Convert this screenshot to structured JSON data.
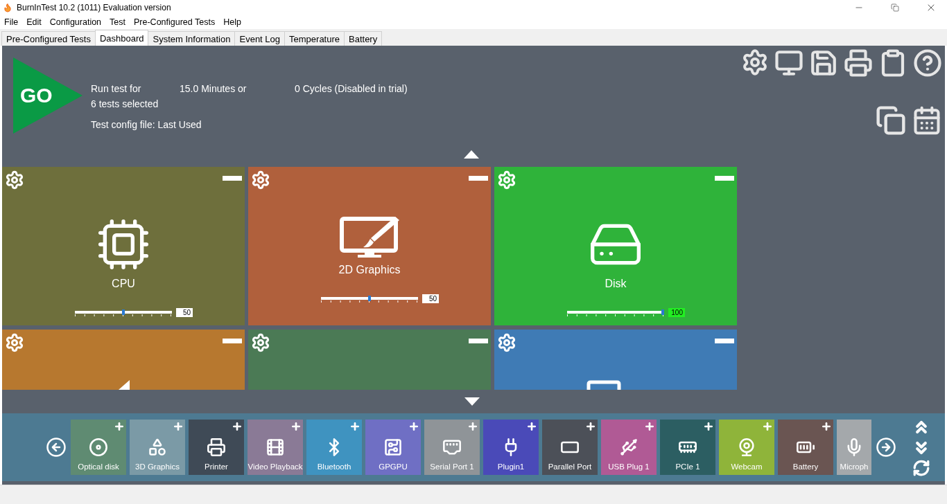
{
  "window": {
    "title": "BurnInTest 10.2 (1011) Evaluation version"
  },
  "menu": [
    "File",
    "Edit",
    "Configuration",
    "Test",
    "Pre-Configured Tests",
    "Help"
  ],
  "tabs": [
    {
      "label": "Pre-Configured Tests",
      "selected": false
    },
    {
      "label": "Dashboard",
      "selected": true
    },
    {
      "label": "System Information",
      "selected": false
    },
    {
      "label": "Event Log",
      "selected": false
    },
    {
      "label": "Temperature",
      "selected": false
    },
    {
      "label": "Battery",
      "selected": false
    }
  ],
  "go_button": {
    "label": "GO"
  },
  "run_info": {
    "run_test_for": "Run test for",
    "duration": "15.0 Minutes or",
    "cycles": "0 Cycles (Disabled in trial)",
    "tests_selected": "6 tests selected",
    "config_file": "Test config file: Last Used"
  },
  "test_tiles": [
    {
      "label": "CPU",
      "color": "#6e6f3c",
      "level": 0.5,
      "reading": "50",
      "reading_highlighted": false
    },
    {
      "label": "2D Graphics",
      "color": "#b0603c",
      "level": 0.5,
      "reading": "50",
      "reading_highlighted": false
    },
    {
      "label": "Disk",
      "color": "#2fb33a",
      "level": 1,
      "reading": "100",
      "reading_highlighted": true
    },
    {
      "color": "#b7782f"
    },
    {
      "color": "#4b7a55"
    },
    {
      "color": "#3f7bb5"
    }
  ],
  "available_tests": [
    {
      "label": "Optical disk",
      "color": "#5f8b72",
      "add": true
    },
    {
      "label": "3D Graphics",
      "color": "#7b9aa6",
      "add": true
    },
    {
      "label": "Printer",
      "color": "#3f4a56",
      "add": true
    },
    {
      "label": "Video Playback",
      "color": "#8a7a96",
      "add": true
    },
    {
      "label": "Bluetooth",
      "color": "#3f93c0",
      "add": true
    },
    {
      "label": "GPGPU",
      "color": "#6f6fc4",
      "add": true
    },
    {
      "label": "Serial Port 1",
      "color": "#8f9498",
      "add": true
    },
    {
      "label": "Plugin1",
      "color": "#4a4ab8",
      "add": true
    },
    {
      "label": "Parallel Port",
      "color": "#4c5058",
      "add": true
    },
    {
      "label": "USB Plug 1",
      "color": "#b05a95",
      "add": true
    },
    {
      "label": "PCIe 1",
      "color": "#2c5e62",
      "add": true
    },
    {
      "label": "Webcam",
      "color": "#8fb43a",
      "add": true
    },
    {
      "label": "Battery",
      "color": "#6a5552",
      "add": true
    },
    {
      "label": "Microph",
      "color": "#a4a8ab",
      "add": false
    }
  ]
}
